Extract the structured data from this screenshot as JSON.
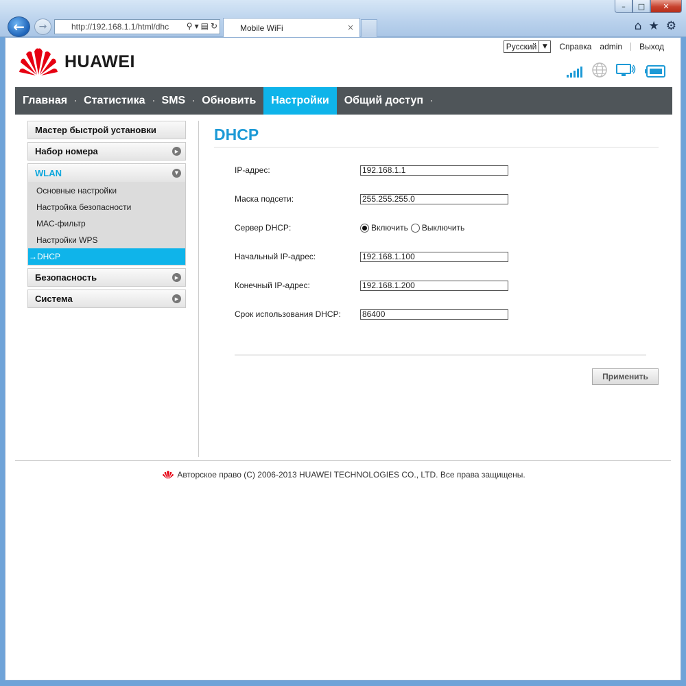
{
  "browser": {
    "address": "http://192.168.1.1/html/dhc",
    "tab_title": "Mobile WiFi",
    "tab_close": "×",
    "win_min": "–",
    "win_max": "□",
    "win_close": "✕"
  },
  "header": {
    "logo_text": "HUAWEI",
    "language": "Русский",
    "help": "Справка",
    "user": "admin",
    "logout": "Выход"
  },
  "nav": {
    "items": [
      "Главная",
      "Статистика",
      "SMS",
      "Обновить",
      "Настройки",
      "Общий доступ"
    ],
    "active": "Настройки"
  },
  "sidebar": {
    "quick_setup": "Мастер быстрой установки",
    "dial": "Набор номера",
    "wlan": "WLAN",
    "wlan_items": [
      "Основные настройки",
      "Настройка безопасности",
      "MAC-фильтр",
      "Настройки WPS"
    ],
    "dhcp_active": "→DHCP",
    "security": "Безопасность",
    "system": "Система"
  },
  "content": {
    "title": "DHCP",
    "ip_label": "IP-адрес:",
    "ip_value": "192.168.1.1",
    "mask_label": "Маска подсети:",
    "mask_value": "255.255.255.0",
    "dhcp_server_label": "Сервер DHCP:",
    "enable": "Включить",
    "disable": "Выключить",
    "dhcp_enabled": true,
    "start_ip_label": "Начальный IP-адрес:",
    "start_ip_value": "192.168.1.100",
    "end_ip_label": "Конечный IP-адрес:",
    "end_ip_value": "192.168.1.200",
    "lease_label": "Срок использования DHCP:",
    "lease_value": "86400",
    "apply": "Применить"
  },
  "footer": {
    "copyright": "Авторское право (C) 2006-2013 HUAWEI TECHNOLOGIES CO., LTD. Все права защищены."
  },
  "colors": {
    "accent": "#0fb4ea",
    "nav_bg": "#4f5559",
    "title": "#1d9ad6",
    "logo_red": "#e60012"
  }
}
